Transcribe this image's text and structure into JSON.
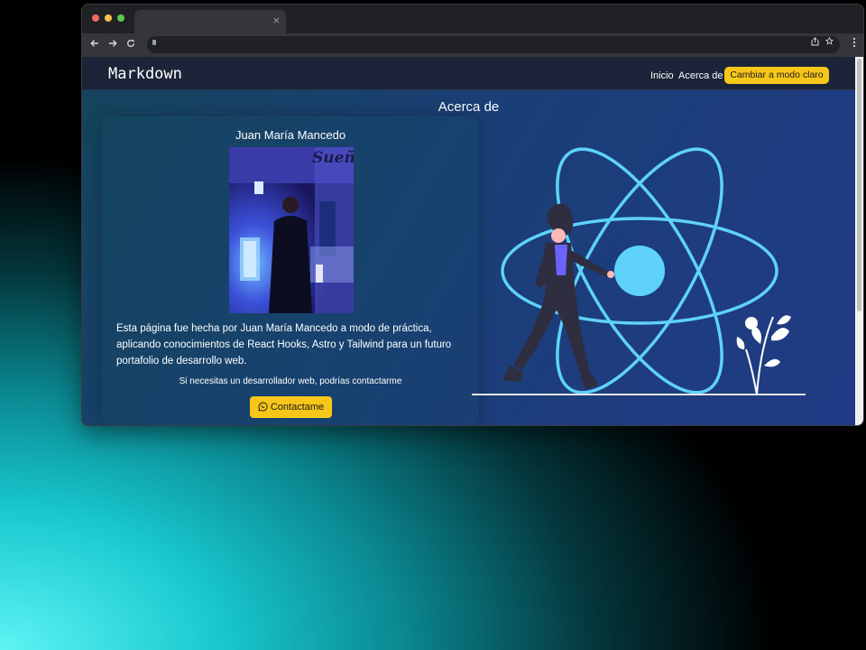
{
  "browser": {
    "tab_close_glyph": "×",
    "back_icon": "arrow-left-icon",
    "forward_icon": "arrow-right-icon",
    "reload_icon": "reload-icon",
    "colors": {
      "close": "#ed6a5e",
      "minimize": "#f5bf4f",
      "zoom": "#61c554"
    }
  },
  "site": {
    "brand": "Markdown",
    "nav": {
      "home": "Inicio",
      "about": "Acerca de",
      "mode_button": "Cambiar a modo claro"
    },
    "accent": "#f6c619"
  },
  "about": {
    "title": "Acerca de",
    "name": "Juan María Mancedo",
    "description": "Esta página fue hecha por Juan María Mancedo a modo de práctica, aplicando conocimientos de React Hooks, Astro y Tailwind para un futuro portafolio de desarrollo web.",
    "contact_hint": "Si necesitas un desarrollador web, podrías contactarme",
    "contact_button": "Contactame",
    "contact_icon": "whatsapp-icon",
    "photo_sign_text": "Sueñ"
  }
}
